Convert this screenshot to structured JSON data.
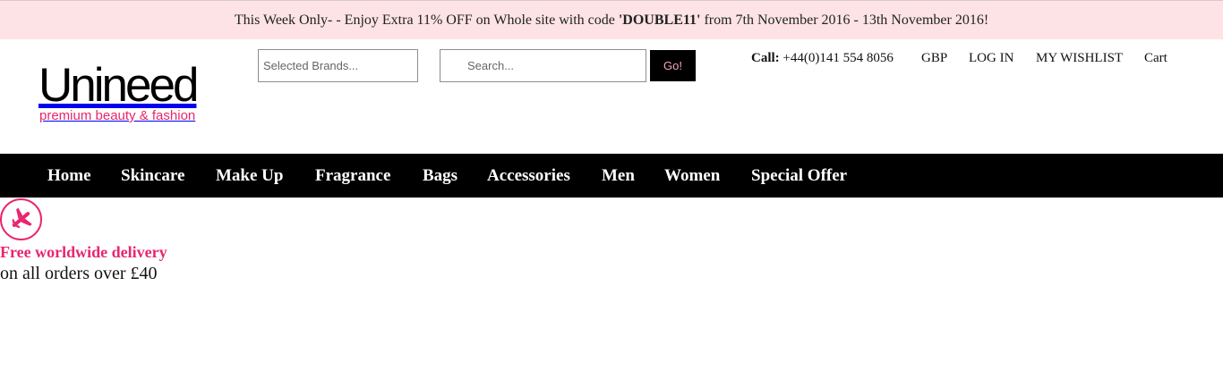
{
  "promo": {
    "prefix": "This Week Only- - Enjoy Extra 11% OFF on Whole site with code ",
    "code": "'DOUBLE11'",
    "suffix": " from 7th November 2016 - 13th November 2016!"
  },
  "logo": {
    "name": "Unineed",
    "tagline": "premium beauty & fashion"
  },
  "search": {
    "brands_placeholder": "Selected Brands...",
    "placeholder": "Search...",
    "go_label": "Go!"
  },
  "utility": {
    "call_label": "Call:",
    "phone": "+44(0)141 554 8056",
    "currency": "GBP",
    "login": "LOG IN",
    "wishlist": "MY WISHLIST",
    "cart": "Cart"
  },
  "nav": {
    "items": [
      "Home",
      "Skincare",
      "Make Up",
      "Fragrance",
      "Bags",
      "Accessories",
      "Men",
      "Women",
      "Special Offer"
    ]
  },
  "delivery": {
    "icon": "airplane-icon",
    "title": "Free worldwide delivery",
    "subtitle": "on all orders over £40"
  },
  "colors": {
    "promo_bg": "#fde3e5",
    "brand_pink": "#e8266e",
    "nav_bg": "#000000",
    "go_text": "#f5a3c6"
  }
}
